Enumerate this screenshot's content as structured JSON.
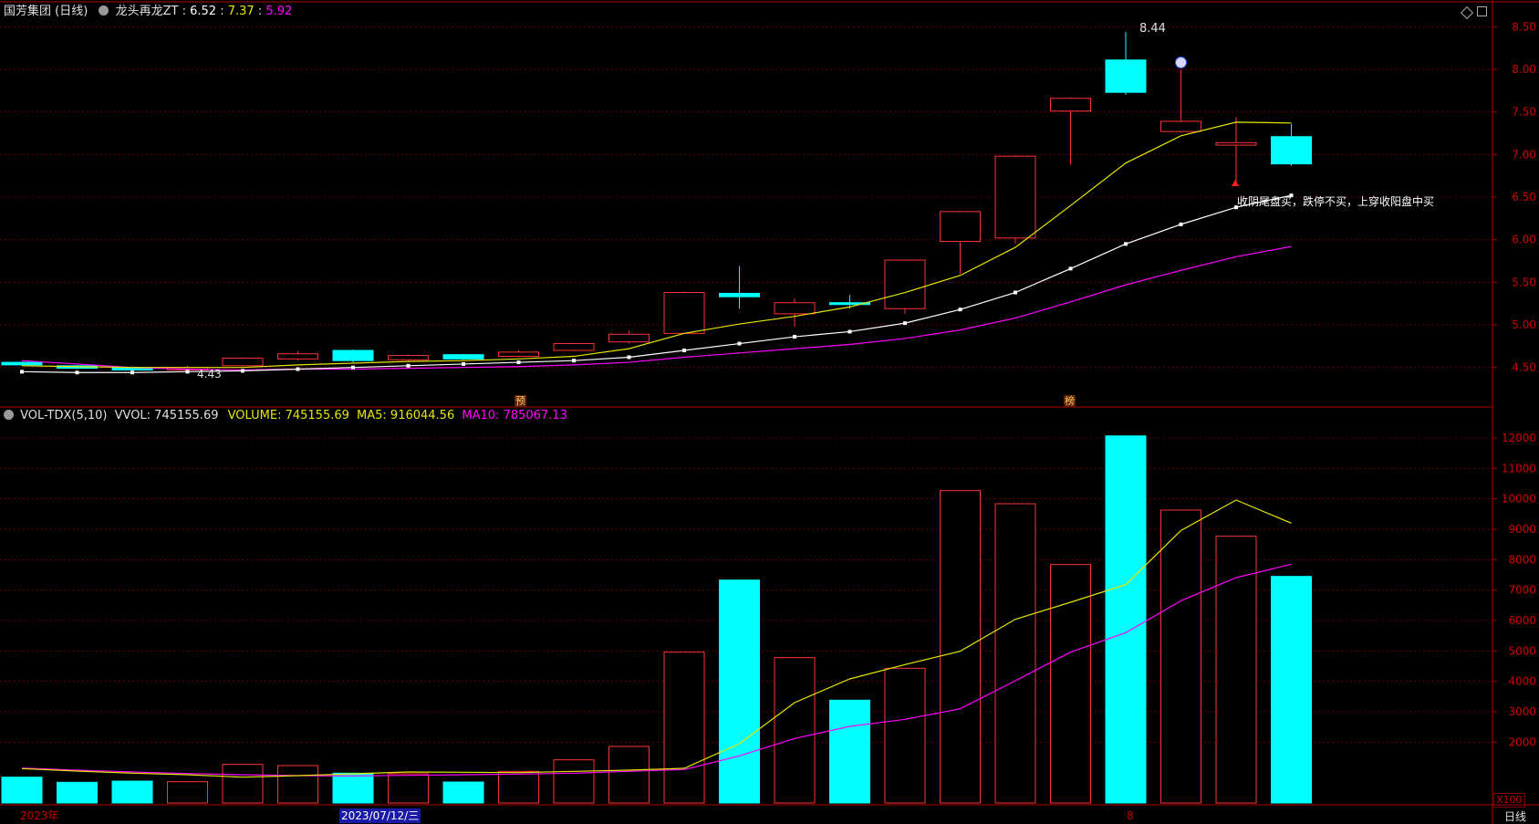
{
  "top_header": {
    "title": "国芳集团 (日线)",
    "indicator_name": "龙头再龙ZT",
    "separator": ":",
    "v1": "6.52",
    "v2": "7.37",
    "v3": "5.92"
  },
  "vol_header": {
    "name": "VOL-TDX(5,10)",
    "vvol": "VVOL: 745155.69",
    "volume": "VOLUME: 745155.69",
    "ma5": "MA5: 916044.56",
    "ma10": "MA10: 785067.13"
  },
  "price_annotations": {
    "high": "8.44",
    "low": "4.43",
    "signal_text": "收阴尾盘买，跌停不买，上穿收阳盘中买",
    "marker_yu": "预",
    "marker_bang": "榜"
  },
  "bottom_bar": {
    "year_label": "2023年",
    "cursor_date": "2023/07/12/三",
    "month_label": "8",
    "period": "日线",
    "scale_label": "X100"
  },
  "colors": {
    "up": "#ff3333",
    "down": "#00ffff",
    "ma_yellow": "#e6e600",
    "ma_white": "#ffffff",
    "ma_magenta": "#ff00ff",
    "axis_red": "#b00000",
    "grid": "#6a0000"
  },
  "chart_data": [
    {
      "type": "candlestick",
      "title": "国芳集团 (日线)",
      "ylim": [
        4.1,
        8.6
      ],
      "yticks": [
        "8.50",
        "8.00",
        "7.50",
        "7.00",
        "6.50",
        "6.00",
        "5.50",
        "5.00",
        "4.50"
      ],
      "candles": [
        {
          "o": 4.56,
          "c": 4.53,
          "h": 4.57,
          "l": 4.52
        },
        {
          "o": 4.52,
          "c": 4.49,
          "h": 4.53,
          "l": 4.48
        },
        {
          "o": 4.5,
          "c": 4.47,
          "h": 4.51,
          "l": 4.46
        },
        {
          "o": 4.47,
          "c": 4.5,
          "h": 4.52,
          "l": 4.43
        },
        {
          "o": 4.52,
          "c": 4.61,
          "h": 4.62,
          "l": 4.51
        },
        {
          "o": 4.6,
          "c": 4.66,
          "h": 4.69,
          "l": 4.58
        },
        {
          "o": 4.7,
          "c": 4.58,
          "h": 4.71,
          "l": 4.56
        },
        {
          "o": 4.59,
          "c": 4.64,
          "h": 4.65,
          "l": 4.58
        },
        {
          "o": 4.65,
          "c": 4.6,
          "h": 4.66,
          "l": 4.59
        },
        {
          "o": 4.63,
          "c": 4.68,
          "h": 4.7,
          "l": 4.62
        },
        {
          "o": 4.7,
          "c": 4.78,
          "h": 4.79,
          "l": 4.69
        },
        {
          "o": 4.8,
          "c": 4.89,
          "h": 4.93,
          "l": 4.78
        },
        {
          "o": 4.9,
          "c": 5.38,
          "h": 5.39,
          "l": 4.9
        },
        {
          "o": 5.37,
          "c": 5.33,
          "h": 5.69,
          "l": 5.19
        },
        {
          "o": 5.13,
          "c": 5.26,
          "h": 5.31,
          "l": 4.98
        },
        {
          "o": 5.26,
          "c": 5.24,
          "h": 5.35,
          "l": 5.19
        },
        {
          "o": 5.19,
          "c": 5.76,
          "h": 5.77,
          "l": 5.13
        },
        {
          "o": 5.98,
          "c": 6.33,
          "h": 6.34,
          "l": 5.6
        },
        {
          "o": 6.02,
          "c": 6.98,
          "h": 6.99,
          "l": 5.95
        },
        {
          "o": 7.51,
          "c": 7.66,
          "h": 7.67,
          "l": 6.88
        },
        {
          "o": 8.11,
          "c": 7.73,
          "h": 8.44,
          "l": 7.7
        },
        {
          "o": 7.27,
          "c": 7.39,
          "h": 8.0,
          "l": 7.26
        },
        {
          "o": 7.11,
          "c": 7.14,
          "h": 7.44,
          "l": 6.66
        },
        {
          "o": 7.21,
          "c": 6.89,
          "h": 7.36,
          "l": 6.87
        }
      ],
      "ma_yellow": [
        4.52,
        4.51,
        4.5,
        4.5,
        4.5,
        4.53,
        4.55,
        4.57,
        4.58,
        4.6,
        4.63,
        4.72,
        4.9,
        5.01,
        5.1,
        5.21,
        5.38,
        5.58,
        5.91,
        6.4,
        6.9,
        7.22,
        7.38,
        7.37
      ],
      "ma_white": [
        4.45,
        4.44,
        4.44,
        4.45,
        4.46,
        4.48,
        4.5,
        4.52,
        4.54,
        4.56,
        4.58,
        4.62,
        4.7,
        4.78,
        4.86,
        4.92,
        5.02,
        5.18,
        5.38,
        5.66,
        5.95,
        6.18,
        6.38,
        6.52
      ],
      "ma_magenta": [
        4.58,
        4.54,
        4.5,
        4.48,
        4.47,
        4.48,
        4.48,
        4.49,
        4.5,
        4.51,
        4.53,
        4.56,
        4.62,
        4.67,
        4.72,
        4.77,
        4.84,
        4.94,
        5.08,
        5.27,
        5.47,
        5.64,
        5.8,
        5.92
      ]
    },
    {
      "type": "bar",
      "title": "VOL-TDX(5,10)",
      "ylim": [
        0,
        12300
      ],
      "yticks": [
        "12000",
        "11000",
        "10000",
        "9000",
        "8000",
        "7000",
        "6000",
        "5000",
        "4000",
        "3000",
        "2000"
      ],
      "values": [
        850,
        680,
        720,
        700,
        1270,
        1230,
        980,
        960,
        690,
        1040,
        1420,
        1860,
        4960,
        7330,
        4780,
        3380,
        4430,
        10270,
        9840,
        7840,
        12070,
        9630,
        8770,
        7450
      ],
      "up": [
        false,
        false,
        false,
        true,
        true,
        true,
        false,
        true,
        false,
        true,
        true,
        true,
        true,
        false,
        true,
        false,
        true,
        true,
        true,
        true,
        false,
        true,
        true,
        false
      ],
      "ma5": [
        1130,
        1050,
        980,
        930,
        850,
        900,
        960,
        1020,
        1010,
        1000,
        1040,
        1080,
        1140,
        1950,
        3300,
        4080,
        4550,
        4990,
        6040,
        6600,
        7180,
        8960,
        9960,
        9200
      ],
      "ma10": [
        1150,
        1080,
        1020,
        970,
        930,
        900,
        890,
        910,
        930,
        950,
        980,
        1040,
        1100,
        1550,
        2120,
        2520,
        2750,
        3100,
        4020,
        4960,
        5600,
        6650,
        7410,
        7850
      ]
    }
  ]
}
